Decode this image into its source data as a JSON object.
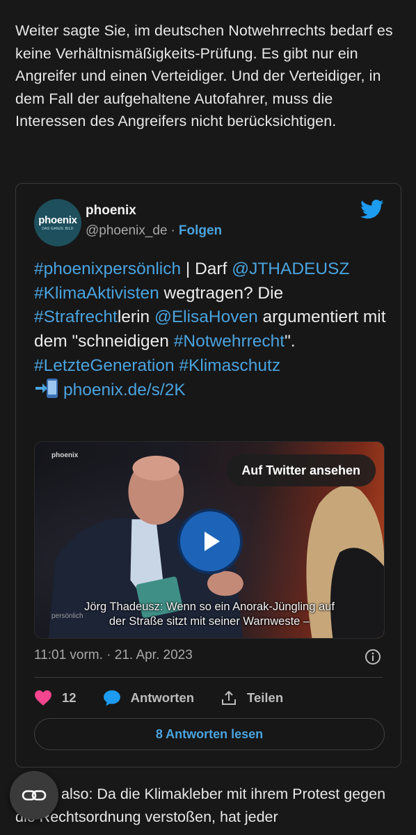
{
  "article": {
    "paragraph_top": "Weiter sagte Sie, im deutschen Notwehrrechts bedarf es keine Verhältnismäßigkeits-Prüfung. Es gibt nur ein Angreifer und einen Verteidiger. Und der Verteidiger, in dem Fall der aufgehaltene Autofahrer, muss die Interessen des Angreifers nicht berücksichtigen.",
    "paragraph_bottom": "also: Da die Klimakleber mit ihrem Protest gegen die Rechtsordnung verstoßen, hat jeder"
  },
  "tweet": {
    "avatar": {
      "logo_word": "phoenix",
      "logo_sub": "DAS GANZE BILD"
    },
    "author_name": "phoenix",
    "author_handle": "@phoenix_de",
    "separator": "·",
    "follow_label": "Folgen",
    "text_parts": [
      {
        "t": "#phoenixpersönlich",
        "link": true
      },
      {
        "t": " | Darf ",
        "link": false
      },
      {
        "t": "@JTHADEUSZ",
        "link": true
      },
      {
        "t": " ",
        "link": false
      },
      {
        "t": "#KlimaAktivisten",
        "link": true
      },
      {
        "t": " wegtragen? Die ",
        "link": false
      },
      {
        "t": "#Strafrecht",
        "link": true
      },
      {
        "t": "lerin ",
        "link": false
      },
      {
        "t": "@ElisaHoven",
        "link": true
      },
      {
        "t": " argumentiert mit dem \"schneidigen ",
        "link": false
      },
      {
        "t": "#Notwehrrecht",
        "link": true
      },
      {
        "t": "\". ",
        "link": false
      },
      {
        "t": "#LetzteGeneration",
        "link": true
      },
      {
        "t": " ",
        "link": false
      },
      {
        "t": "#Klimaschutz",
        "link": true
      }
    ],
    "link_text": "phoenix.de/s/2K",
    "media": {
      "watermark": "phoenix",
      "watermark_bottom": "persönlich",
      "view_on_twitter": "Auf Twitter ansehen",
      "subtitle_line1": "Jörg Thadeusz: Wenn so ein Anorak-Jüngling auf",
      "subtitle_line2": "der Straße sitzt mit seiner Warnweste –"
    },
    "timestamp": "11:01 vorm. · 21. Apr. 2023",
    "like_count": "12",
    "reply_label": "Antworten",
    "share_label": "Teilen",
    "read_replies_label": "8 Antworten lesen"
  },
  "colors": {
    "background": "#181818",
    "link": "#4aa3df",
    "heart": "#f5468f",
    "twitter_blue": "#1d9bf0"
  },
  "icons": [
    "twitter-bird-icon",
    "play-icon",
    "info-icon",
    "heart-icon",
    "reply-bubble-icon",
    "share-icon",
    "link-icon",
    "phone-arrow-icon"
  ]
}
